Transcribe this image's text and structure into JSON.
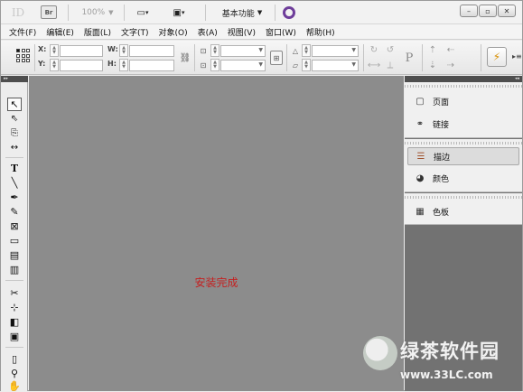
{
  "appbar": {
    "app_logo": "ID",
    "bridge_label": "Br",
    "zoom_value": "100%",
    "workspace_label": "基本功能",
    "screen_mode_arrow": "▾",
    "view_arrow": "▾",
    "win_minimize": "–",
    "win_restore": "▫",
    "win_close": "✕"
  },
  "menu": {
    "items": [
      "文件(F)",
      "编辑(E)",
      "版面(L)",
      "文字(T)",
      "对象(O)",
      "表(A)",
      "视图(V)",
      "窗口(W)",
      "帮助(H)"
    ]
  },
  "control": {
    "x_label": "X:",
    "y_label": "Y:",
    "w_label": "W:",
    "h_label": "H:"
  },
  "canvas": {
    "status_text": "安装完成"
  },
  "panels": {
    "items": [
      {
        "label": "页面",
        "icon": "pages-icon"
      },
      {
        "label": "链接",
        "icon": "links-icon"
      },
      {
        "label": "描边",
        "icon": "stroke-icon"
      },
      {
        "label": "颜色",
        "icon": "color-icon"
      },
      {
        "label": "色板",
        "icon": "swatches-icon"
      }
    ]
  },
  "watermark": {
    "title": "绿茶软件园",
    "url": "www.33LC.com"
  },
  "colors": {
    "canvas_bg": "#8c8c8c",
    "status_text": "#c42020",
    "dock_bg": "#727272"
  }
}
